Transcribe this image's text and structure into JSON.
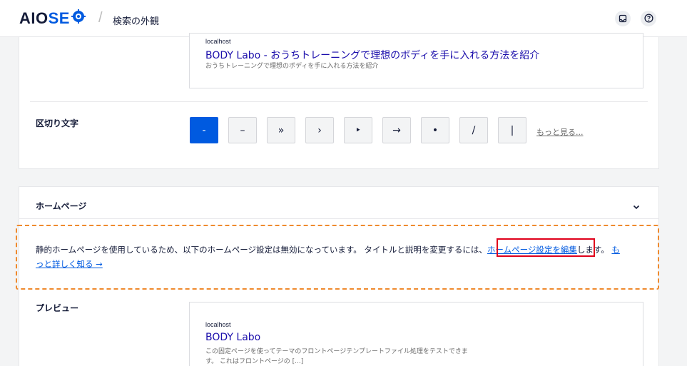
{
  "header": {
    "logo_prefix": "AIO",
    "logo_suffix": "SE",
    "separator": "/",
    "breadcrumb": "検索の外観"
  },
  "site_preview": {
    "host": "localhost",
    "title": "BODY Labo - おうちトレーニングで理想のボディを手に入れる方法を紹介",
    "description": "おうちトレーニングで理想のボディを手に入れる方法を紹介"
  },
  "separator_setting": {
    "label": "区切り文字",
    "options": [
      "-",
      "–",
      "»",
      "›",
      "‣",
      "→",
      "•",
      "/",
      "|"
    ],
    "selected_index": 0,
    "more_link": "もっと見る..."
  },
  "homepage": {
    "heading": "ホームページ",
    "notice_before": "静的ホームページを使用しているため、以下のホームページ設定は無効になっています。 タイトルと説明を変更するには、",
    "notice_link": "ホームページ設定を編集",
    "notice_after": "します。",
    "learn_more_part1": "も",
    "learn_more_part2": "っと詳しく知る →",
    "preview_label": "プレビュー",
    "preview": {
      "host": "localhost",
      "title": "BODY Labo",
      "description_line1": "この固定ページを使ってテーマのフロントページテンプレートファイル処理をテストできま",
      "description_line2": "す。 これはフロントページの [...]"
    }
  },
  "colors": {
    "accent": "#005ae0",
    "notice_border": "#ef8a2e",
    "highlight_box": "#e0001b",
    "link_title": "#1a0dab"
  }
}
